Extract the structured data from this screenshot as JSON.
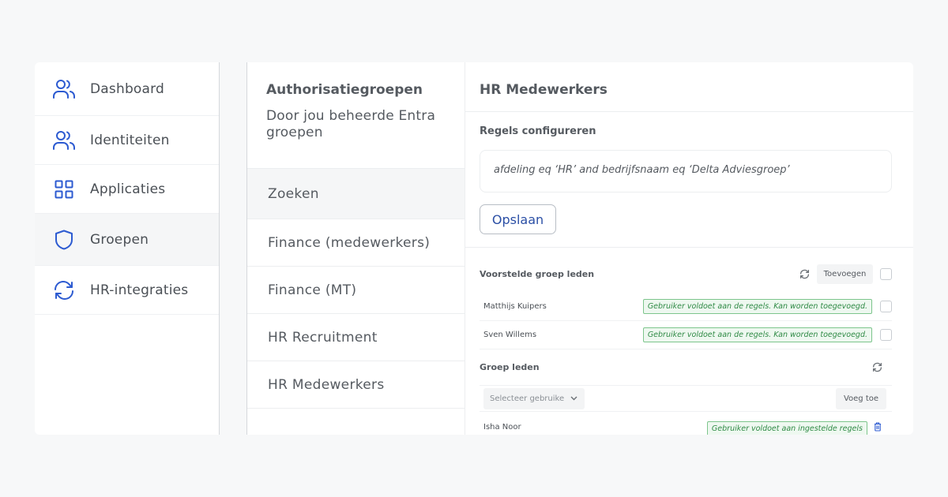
{
  "colors": {
    "accent": "#2b4fa5",
    "icon": "#2d5bd1",
    "badge_bg": "#eef8f0",
    "badge_border": "#7dc58c",
    "badge_text": "#2f8a45"
  },
  "sidebar": {
    "items": [
      {
        "label": "Dashboard",
        "icon": "users-icon",
        "active": false
      },
      {
        "label": "Identiteiten",
        "icon": "users-icon",
        "active": false
      },
      {
        "label": "Applicaties",
        "icon": "grid-icon",
        "active": false
      },
      {
        "label": "Groepen",
        "icon": "shield-icon",
        "active": true
      },
      {
        "label": "HR-integraties",
        "icon": "sync-icon",
        "active": false
      }
    ]
  },
  "groups": {
    "title": "Authorisatiegroepen",
    "subtitle": "Door jou beheerde Entra groepen",
    "search_label": "Zoeken",
    "items": [
      "Finance (medewerkers)",
      "Finance (MT)",
      "HR Recruitment",
      "HR Medewerkers"
    ]
  },
  "detail": {
    "title": "HR Medewerkers",
    "rules_heading": "Regels configureren",
    "rule_text": "afdeling eq ‘HR’ and bedrijfsnaam eq ‘Delta Adviesgroep’",
    "save_label": "Opslaan",
    "suggested": {
      "heading": "Voorstelde groep leden",
      "add_label": "Toevoegen",
      "members": [
        {
          "name": "Matthijs Kuipers",
          "status": "Gebruiker voldoet aan de regels. Kan worden toegevoegd."
        },
        {
          "name": "Sven Willems",
          "status": "Gebruiker voldoet aan de regels. Kan worden toegevoegd."
        }
      ]
    },
    "members": {
      "heading": "Groep leden",
      "select_placeholder": "Selecteer gebruike",
      "add_label": "Voeg toe",
      "list": [
        {
          "name": "Isha Noor",
          "status": "Gebruiker voldoet aan ingestelde regels"
        }
      ]
    }
  }
}
